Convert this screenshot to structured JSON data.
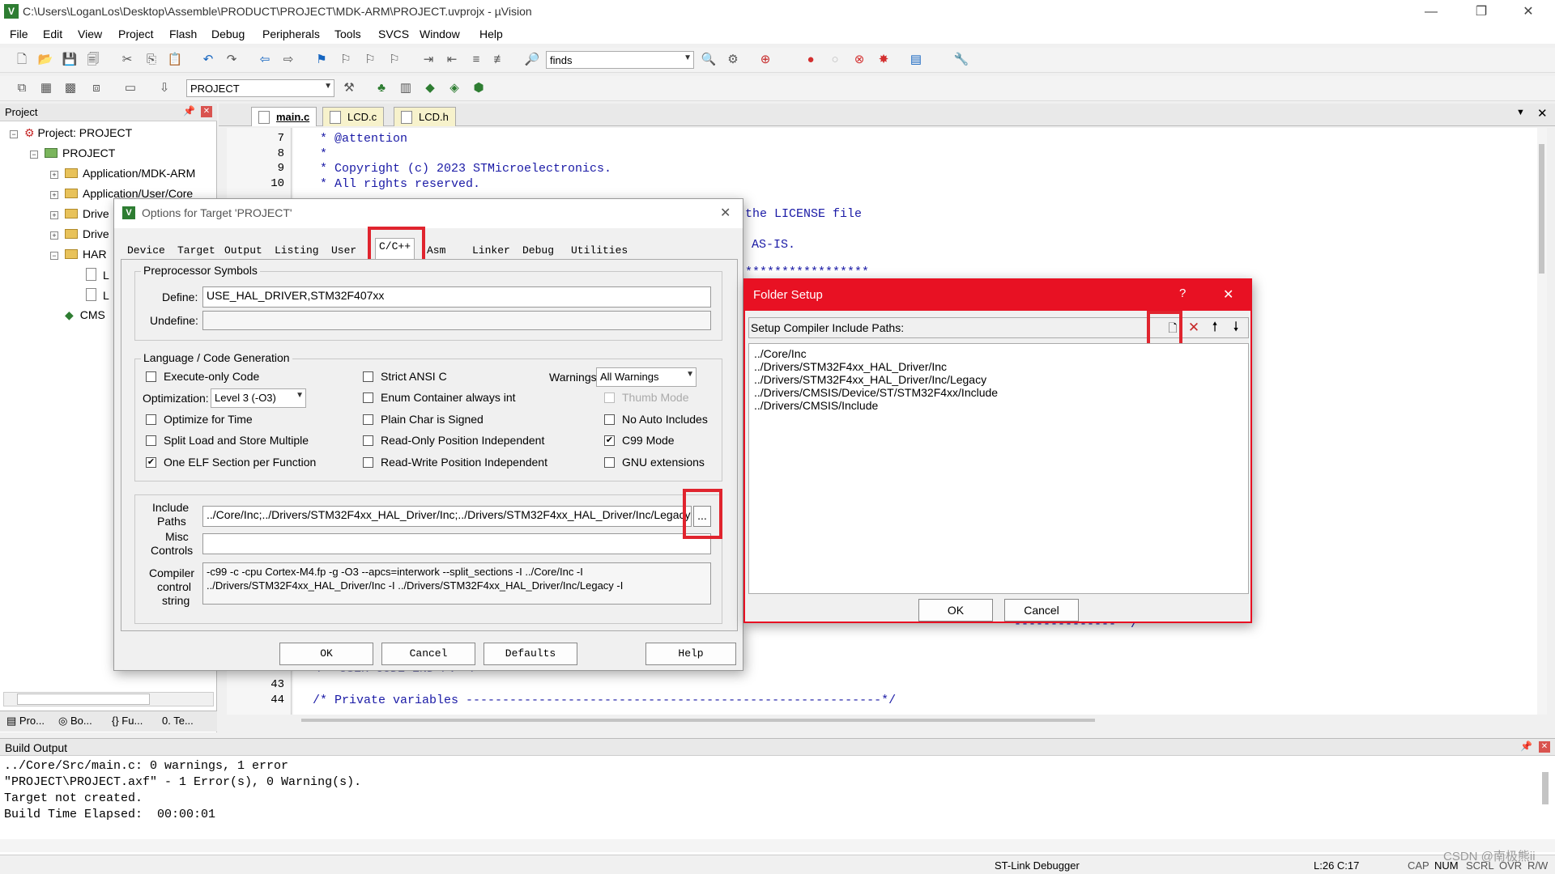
{
  "window": {
    "title": "C:\\Users\\LoganLos\\Desktop\\Assemble\\PRODUCT\\PROJECT\\MDK-ARM\\PROJECT.uvprojx - µVision"
  },
  "menu": [
    "File",
    "Edit",
    "View",
    "Project",
    "Flash",
    "Debug",
    "Peripherals",
    "Tools",
    "SVCS",
    "Window",
    "Help"
  ],
  "toolbar": {
    "find_value": "finds",
    "target_value": "PROJECT"
  },
  "project_panel": {
    "title": "Project",
    "root": "Project: PROJECT",
    "target": "PROJECT",
    "groups": [
      "Application/MDK-ARM",
      "Application/User/Core",
      "Drive",
      "Drive",
      "HAR"
    ],
    "files": [
      "L",
      "L"
    ],
    "cmsis": "CMS"
  },
  "bottom_tabs": [
    "Pro...",
    "Bo...",
    "Fu...",
    "Te..."
  ],
  "editor": {
    "tabs": [
      "main.c",
      "LCD.c",
      "LCD.h"
    ],
    "lines": [
      {
        "n": "7",
        "code": " * @attention"
      },
      {
        "n": "8",
        "code": " *"
      },
      {
        "n": "9",
        "code": " * Copyright (c) 2023 STMicroelectronics."
      },
      {
        "n": "10",
        "code": " * All rights reserved."
      }
    ],
    "fragments": [
      "the LICENSE file",
      "AS-IS.",
      "*****************",
      "-------------- */"
    ],
    "bottom_lines": [
      {
        "n": "43",
        "code": ""
      },
      {
        "n": "44",
        "code": "/* Private variables ---------------------------------------------------------*/"
      }
    ],
    "partial_line": "/* USER CODE END PV */"
  },
  "build": {
    "title": "Build Output",
    "lines": [
      "../Core/Src/main.c: 0 warnings, 1 error",
      "\"PROJECT\\PROJECT.axf\" - 1 Error(s), 0 Warning(s).",
      "Target not created.",
      "Build Time Elapsed:  00:00:01"
    ]
  },
  "status": {
    "debugger": "ST-Link Debugger",
    "pos": "L:26 C:17",
    "caps": "CAP",
    "num": "NUM",
    "scrl": "SCRL",
    "ovr": "OVR",
    "rw": "R/W",
    "watermark": "CSDN @南极熊ii"
  },
  "options_dialog": {
    "title": "Options for Target 'PROJECT'",
    "tabs": [
      "Device",
      "Target",
      "Output",
      "Listing",
      "User",
      "C/C++",
      "Asm",
      "Linker",
      "Debug",
      "Utilities"
    ],
    "preproc_title": "Preprocessor Symbols",
    "define_label": "Define:",
    "define_value": "USE_HAL_DRIVER,STM32F407xx",
    "undefine_label": "Undefine:",
    "lang_title": "Language / Code Generation",
    "execute_only": "Execute-only Code",
    "optimization_label": "Optimization:",
    "optimization_value": "Level 3 (-O3)",
    "optimize_time": "Optimize for Time",
    "split_load": "Split Load and Store Multiple",
    "one_elf": "One ELF Section per Function",
    "strict_ansi": "Strict ANSI C",
    "enum_container": "Enum Container always int",
    "plain_char": "Plain Char is Signed",
    "ro_pos": "Read-Only Position Independent",
    "rw_pos": "Read-Write Position Independent",
    "warnings_label": "Warnings:",
    "warnings_value": "All Warnings",
    "thumb_mode": "Thumb Mode",
    "no_auto": "No Auto Includes",
    "c99": "C99 Mode",
    "gnu_ext": "GNU extensions",
    "include_label_1": "Include",
    "include_label_2": "Paths",
    "include_value": "../Core/Inc;../Drivers/STM32F4xx_HAL_Driver/Inc;../Drivers/STM32F4xx_HAL_Driver/Inc/Legacy",
    "browse_label": "...",
    "misc_label_1": "Misc",
    "misc_label_2": "Controls",
    "compiler_label_1": "Compiler",
    "compiler_label_2": "control",
    "compiler_label_3": "string",
    "compiler_line1": "-c99 -c -cpu Cortex-M4.fp -g -O3 --apcs=interwork --split_sections -I ../Core/Inc -I",
    "compiler_line2": "../Drivers/STM32F4xx_HAL_Driver/Inc -I ../Drivers/STM32F4xx_HAL_Driver/Inc/Legacy -I",
    "buttons": {
      "ok": "OK",
      "cancel": "Cancel",
      "defaults": "Defaults",
      "help": "Help"
    },
    "checked": {
      "one_elf": true,
      "c99": true
    }
  },
  "folder_dialog": {
    "title": "Folder Setup",
    "help": "?",
    "close": "✕",
    "label": "Setup Compiler Include Paths:",
    "paths": [
      "../Core/Inc",
      "../Drivers/STM32F4xx_HAL_Driver/Inc",
      "../Drivers/STM32F4xx_HAL_Driver/Inc/Legacy",
      "../Drivers/CMSIS/Device/ST/STM32F4xx/Include",
      "../Drivers/CMSIS/Include"
    ],
    "ok": "OK",
    "cancel": "Cancel"
  },
  "colors": {
    "accent_red": "#e0242e",
    "dialog_title_red": "#e81123",
    "code_blue": "#1a1aa6"
  }
}
